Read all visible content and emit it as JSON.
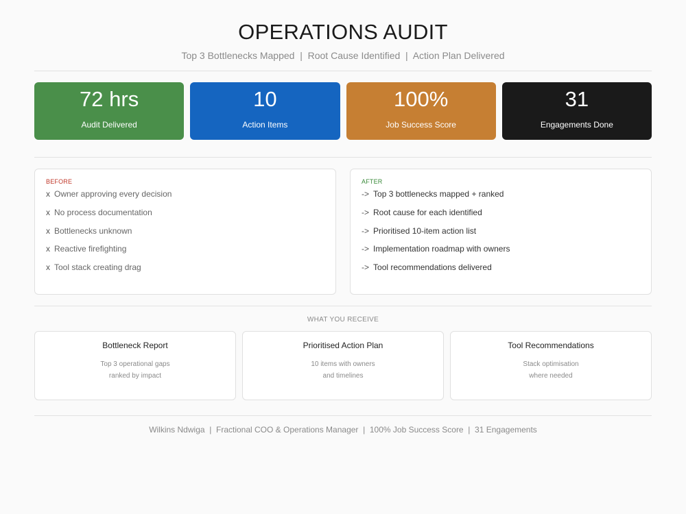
{
  "header": {
    "title": "OPERATIONS AUDIT",
    "subtitle": "Top 3 Bottlenecks Mapped  |  Root Cause Identified  |  Action Plan Delivered"
  },
  "stats": [
    {
      "value": "72 hrs",
      "label": "Audit Delivered",
      "color": "#4a8f4a"
    },
    {
      "value": "10",
      "label": "Action Items",
      "color": "#1565c0"
    },
    {
      "value": "100%",
      "label": "Job Success Score",
      "color": "#c67f33"
    },
    {
      "value": "31",
      "label": "Engagements Done",
      "color": "#1a1a1a"
    }
  ],
  "before": {
    "heading": "BEFORE",
    "marker": "x",
    "items": [
      "Owner approving every decision",
      "No process documentation",
      "Bottlenecks unknown",
      "Reactive firefighting",
      "Tool stack creating drag"
    ]
  },
  "after": {
    "heading": "AFTER",
    "marker": "->",
    "items": [
      "Top 3 bottlenecks mapped + ranked",
      "Root cause for each identified",
      "Prioritised 10-item action list",
      "Implementation roadmap with owners",
      "Tool recommendations delivered"
    ]
  },
  "receive": {
    "heading": "WHAT YOU RECEIVE",
    "cards": [
      {
        "title": "Bottleneck Report",
        "line1": "Top 3 operational gaps",
        "line2": "ranked by impact"
      },
      {
        "title": "Prioritised Action Plan",
        "line1": "10 items with owners",
        "line2": "and timelines"
      },
      {
        "title": "Tool Recommendations",
        "line1": "Stack optimisation",
        "line2": "where needed"
      }
    ]
  },
  "footer": {
    "text": "Wilkins Ndwiga  |  Fractional COO & Operations Manager  |  100% Job Success Score  |  31 Engagements"
  }
}
